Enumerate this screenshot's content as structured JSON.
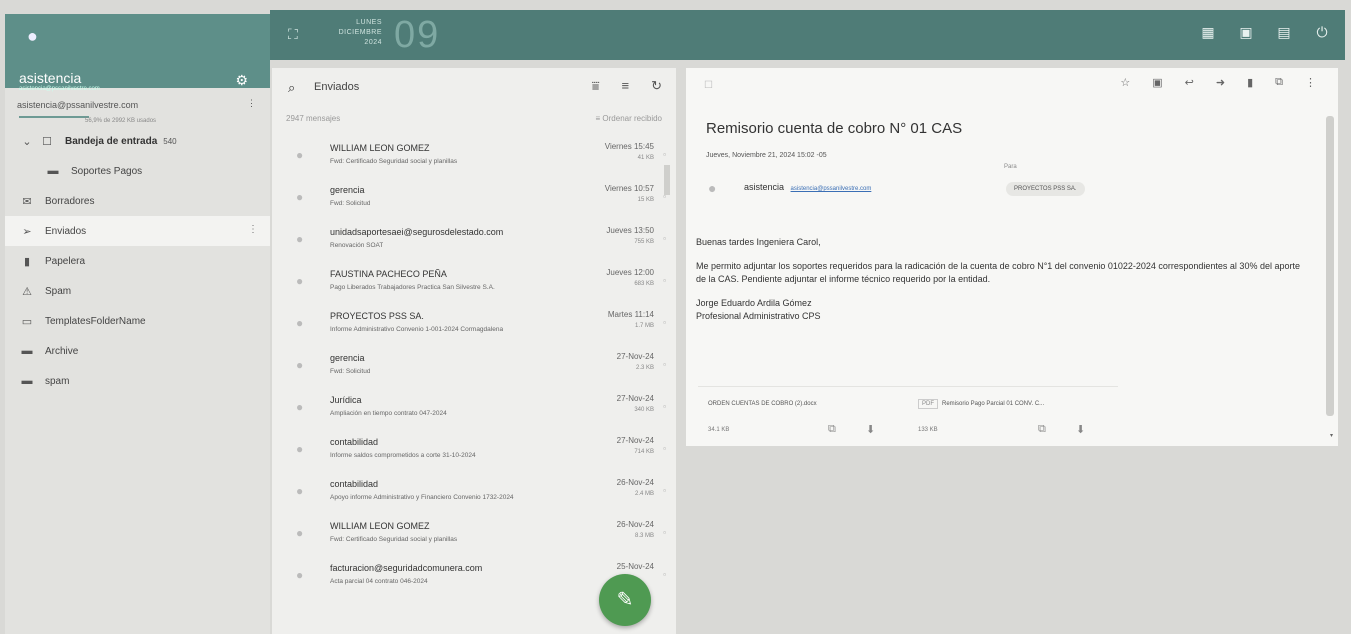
{
  "header": {
    "date_small": [
      "LUNES",
      "DICIEMBRE",
      "2024"
    ],
    "date_big": "09"
  },
  "account": {
    "name": "asistencia",
    "email_short": "asistencia@pssanilvestre.com",
    "email_line": "asistencia@pssanilvestre.com",
    "quota": "56,9% de 2992 KB usados"
  },
  "folders": [
    {
      "label": "Bandeja de entrada",
      "badge": "540",
      "icon": "inbox-icon",
      "glyph": "☐"
    },
    {
      "label": "Soportes Pagos",
      "badge": "",
      "icon": "folder-icon",
      "glyph": "▬"
    },
    {
      "label": "Borradores",
      "badge": "",
      "icon": "drafts-icon",
      "glyph": "✉"
    },
    {
      "label": "Enviados",
      "badge": "",
      "icon": "send-icon",
      "glyph": "➢"
    },
    {
      "label": "Papelera",
      "badge": "",
      "icon": "trash-icon",
      "glyph": "▮"
    },
    {
      "label": "Spam",
      "badge": "",
      "icon": "spam-icon",
      "glyph": "⚠"
    },
    {
      "label": "TemplatesFolderName",
      "badge": "",
      "icon": "template-icon",
      "glyph": "▭"
    },
    {
      "label": "Archive",
      "badge": "",
      "icon": "folder-icon",
      "glyph": "▬"
    },
    {
      "label": "spam",
      "badge": "",
      "icon": "folder-icon",
      "glyph": "▬"
    }
  ],
  "list": {
    "title": "Enviados",
    "count": "2947 mensajes",
    "sort": "Ordenar recibido",
    "messages": [
      {
        "from": "WILLIAM LEON GOMEZ",
        "subject": "Fwd: Certificado Seguridad social y planillas",
        "date": "Viernes 15:45",
        "size": "41 KB"
      },
      {
        "from": "gerencia",
        "subject": "Fwd: Solicitud",
        "date": "Viernes 10:57",
        "size": "15 KB"
      },
      {
        "from": "unidadsaportesaei@segurosdelestado.com",
        "subject": "Renovación SOAT",
        "date": "Jueves 13:50",
        "size": "755 KB"
      },
      {
        "from": "FAUSTINA PACHECO PEÑA",
        "subject": "Pago Liberados Trabajadores Practica San Silvestre S.A.",
        "date": "Jueves 12:00",
        "size": "683 KB"
      },
      {
        "from": "PROYECTOS PSS SA.",
        "subject": "Informe Administrativo Convenio 1-001-2024 Cormagdalena",
        "date": "Martes 11:14",
        "size": "1.7 MB"
      },
      {
        "from": "gerencia",
        "subject": "Fwd: Solicitud",
        "date": "27-Nov-24",
        "size": "2.3 KB"
      },
      {
        "from": "Jurídica",
        "subject": "Ampliación en tiempo contrato 047-2024",
        "date": "27-Nov-24",
        "size": "340 KB"
      },
      {
        "from": "contabilidad",
        "subject": "Informe saldos comprometidos a corte 31-10-2024",
        "date": "27-Nov-24",
        "size": "714 KB"
      },
      {
        "from": "contabilidad",
        "subject": "Apoyo informe Administrativo y Financiero Convenio 1732-2024",
        "date": "26-Nov-24",
        "size": "2.4 MB"
      },
      {
        "from": "WILLIAM LEON GOMEZ",
        "subject": "Fwd: Certificado Seguridad social y planillas",
        "date": "26-Nov-24",
        "size": "8.3 MB"
      },
      {
        "from": "facturacion@seguridadcomunera.com",
        "subject": "Acta parcial 04 contrato 046-2024",
        "date": "25-Nov-24",
        "size": ""
      }
    ]
  },
  "reader": {
    "title": "Remisorio cuenta de cobro N° 01 CAS",
    "date": "Jueves, Noviembre 21, 2024 15:02 -05",
    "sender": "asistencia",
    "sender_email": "asistencia@pssanilvestre.com",
    "to_label": "Para",
    "to": "PROYECTOS PSS SA.",
    "greeting": "Buenas tardes Ingeniera Carol,",
    "body": "Me permito adjuntar los soportes requeridos para la radicación de la cuenta de cobro N°1 del convenio 01022-2024 correspondientes al 30% del aporte de la CAS. Pendiente adjuntar el informe técnico requerido por la entidad.",
    "signature_name": "Jorge Eduardo Ardila Gómez",
    "signature_role": "Profesional Administrativo CPS",
    "attachments": [
      {
        "tag": "",
        "name": "ORDEN CUENTAS DE COBRO (2).docx",
        "size": "34.1 KB"
      },
      {
        "tag": "PDF",
        "name": "Remisorio Pago Parcial 01 CONV. C...",
        "size": "133 KB"
      }
    ]
  }
}
